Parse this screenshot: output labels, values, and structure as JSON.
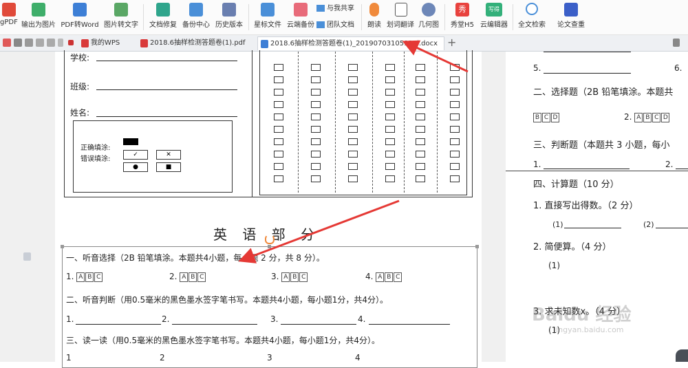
{
  "toolbar": {
    "items": [
      {
        "label": "gPDF",
        "icon": "pdf-icon"
      },
      {
        "label": "输出为图片",
        "icon": "export-image-icon"
      },
      {
        "label": "PDF转Word",
        "icon": "pdf-to-word-icon"
      },
      {
        "label": "图片转文字",
        "icon": "image-to-text-icon"
      },
      {
        "label": "文档修复",
        "icon": "doc-repair-icon"
      },
      {
        "label": "备份中心",
        "icon": "backup-icon"
      },
      {
        "label": "历史版本",
        "icon": "history-icon"
      },
      {
        "label": "星标文件",
        "icon": "star-file-icon"
      },
      {
        "label": "云端备份",
        "icon": "cloud-backup-icon"
      },
      {
        "label": "与我共享",
        "icon": "shared-icon"
      },
      {
        "label": "团队文档",
        "icon": "team-doc-icon"
      },
      {
        "label": "朗读",
        "icon": "read-aloud-icon"
      },
      {
        "label": "划词翻译",
        "icon": "translate-icon"
      },
      {
        "label": "几何图",
        "icon": "geometry-icon"
      },
      {
        "label": "秀堂H5",
        "icon": "xiutang-icon"
      },
      {
        "label": "云编辑器",
        "icon": "cloud-editor-icon"
      },
      {
        "label": "全文检索",
        "icon": "search-icon"
      },
      {
        "label": "论文查重",
        "icon": "plagiarism-check-icon"
      }
    ],
    "xiutang_badge": "秀",
    "editor_badge": "写得"
  },
  "tabs": [
    {
      "label": "我的WPS"
    },
    {
      "label": "2018.6抽样检测答题卷(1).pdf"
    },
    {
      "label": "2018.6抽样检测答题卷(1)_20190703105936l.docx"
    }
  ],
  "new_tab_symbol": "+",
  "left_page": {
    "school_label": "学校:",
    "class_label": "班级:",
    "name_label": "姓名:",
    "correct_fill_label": "正确填涂:",
    "wrong_fill_label": "错误填涂:",
    "wrong_marks": [
      "✓",
      "✕",
      "●",
      "■"
    ],
    "grid_cell_text": "[□]",
    "section_title": "英 语 部 分",
    "q1_title": "一、听音选择（2B 铅笔填涂。本题共4小题，每小题 2 分，共 8 分）。",
    "q1_numbers": [
      "1.",
      "2.",
      "3.",
      "4."
    ],
    "options": [
      "A",
      "B",
      "C"
    ],
    "q2_title": "二、听音判断（用0.5毫米的黑色墨水签字笔书写。本题共4小题，每小题1分，共4分）。",
    "q2_numbers": [
      "1.",
      "2.",
      "3.",
      "4."
    ],
    "q3_title": "三、读一读（用0.5毫米的黑色墨水签字笔书写。本题共4小题，每小题1分，共4分）。",
    "q3_numbers": [
      "1",
      "2",
      "3",
      "4"
    ]
  },
  "right_page": {
    "q5_label": "5.",
    "q6_label": "6.",
    "choice_title": "二、选择题（2B 铅笔填涂。本题共",
    "choice_options_1": [
      "B",
      "C",
      "D"
    ],
    "choice_num_2": "2.",
    "choice_options_2": [
      "A",
      "B",
      "C",
      "D"
    ],
    "judge_title": "三、判断题（本题共 3 小题，每小",
    "judge_1": "1.",
    "judge_2": "2.",
    "calc_title": "四、计算题（10 分）",
    "calc_1": "1. 直接写出得数。（2 分）",
    "calc_1_a": "(1)",
    "calc_1_b": "(2)",
    "calc_2": "2. 简便算。（4 分）",
    "calc_2_a": "(1)",
    "calc_3": "3. 求未知数x。（4 分）",
    "calc_3_a": "(1)",
    "watermark": "Baidu 经验",
    "watermark_url": "jingyan.baidu.com"
  },
  "colors": {
    "arrow": "#e53935",
    "accent_blue": "#4a8fd8",
    "tab_active_border": "#cfd4da"
  }
}
